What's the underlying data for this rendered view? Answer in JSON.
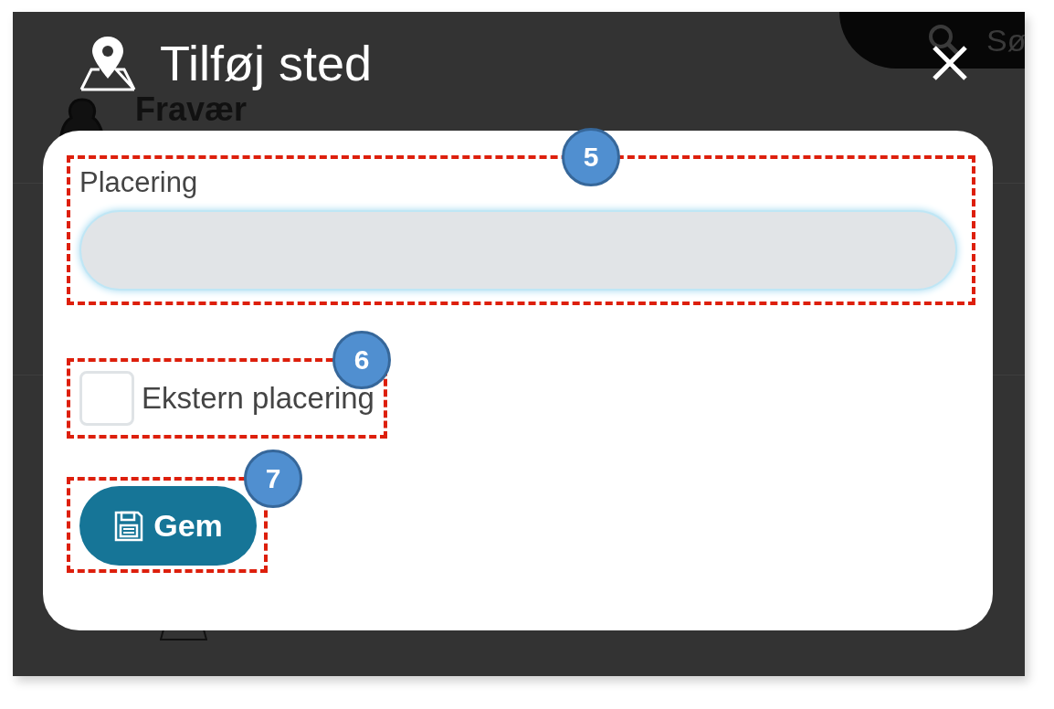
{
  "background": {
    "section_title": "Fravær",
    "search_label": "Sø"
  },
  "dialog": {
    "title": "Tilføj sted"
  },
  "form": {
    "location_field": {
      "label": "Placering",
      "focused": true,
      "badge": "5"
    },
    "external_checkbox": {
      "label": "Ekstern placering",
      "checked": false,
      "badge": "6"
    },
    "save_button": {
      "label": "Gem",
      "badge": "7"
    }
  }
}
